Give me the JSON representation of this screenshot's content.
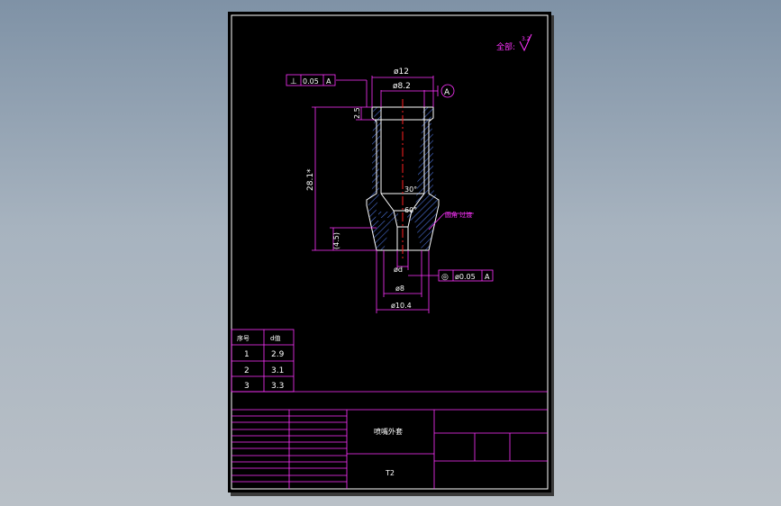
{
  "drawing": {
    "surface_roughness": "全部:",
    "roughness_value": "3.2",
    "dimensions": {
      "outer_top_dia": "ø12",
      "inner_top_dia": "ø8.2",
      "top_flange_height": "2.5",
      "body_length": "28.1*",
      "bottom_height": "(4.5)",
      "orifice_dia": "ød",
      "bottom_dia_8": "ø8",
      "bottom_dia_104": "ø10.4",
      "angle_30": "30°",
      "angle_60": "60°"
    },
    "datum_label": "A",
    "perp_tolerance": {
      "symbol": "⊥",
      "value": "0.05",
      "datum": "A"
    },
    "conc_tolerance": {
      "symbol": "◎",
      "value": "ø0.05",
      "datum": "A"
    },
    "note": "圆角 过渡"
  },
  "size_table": {
    "headers": [
      "序号",
      "d值"
    ],
    "rows": [
      {
        "no": "1",
        "d": "2.9"
      },
      {
        "no": "2",
        "d": "3.1"
      },
      {
        "no": "3",
        "d": "3.3"
      }
    ]
  },
  "title_block": {
    "part_name": "喷嘴外套",
    "material": "T2"
  },
  "colors": {
    "frame": "#e600e6",
    "outline": "#ffffff",
    "centerline": "#ff2020",
    "hatch": "#4a6fd6",
    "background": "#000000"
  }
}
